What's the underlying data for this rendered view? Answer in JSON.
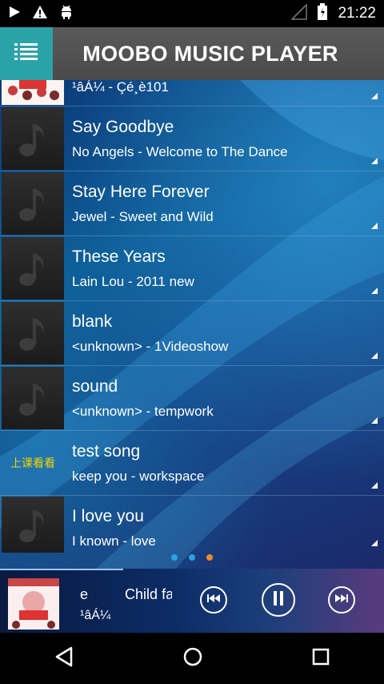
{
  "status_bar": {
    "time": "21:22",
    "left_icons": [
      "play-icon",
      "warning-icon",
      "android-debug-icon"
    ],
    "right_icons": [
      "signal-icon",
      "battery-icon"
    ]
  },
  "header": {
    "title": "MOOBO MUSIC PLAYER",
    "menu_icon": "list-menu-icon"
  },
  "songs": [
    {
      "title": "",
      "subtitle": "¹âÁ¼ - Çé¸è101",
      "thumb": "album-art"
    },
    {
      "title": "Say Goodbye",
      "subtitle": "No Angels - Welcome to The Dance",
      "thumb": "music-note"
    },
    {
      "title": "Stay Here Forever",
      "subtitle": "Jewel - Sweet and Wild",
      "thumb": "music-note"
    },
    {
      "title": "These Years",
      "subtitle": "Lain Lou - 2011 new",
      "thumb": "music-note"
    },
    {
      "title": "blank",
      "subtitle": "<unknown> - 1Videoshow",
      "thumb": "music-note"
    },
    {
      "title": "sound",
      "subtitle": "<unknown> - tempwork",
      "thumb": "music-note"
    },
    {
      "title": "test song",
      "subtitle": "keep you - workspace",
      "thumb": "text",
      "thumb_caption": "上课看看"
    },
    {
      "title": "I love you",
      "subtitle": "I known - love",
      "thumb": "music-note"
    }
  ],
  "page_dots": {
    "count": 3,
    "active": 2,
    "colors": [
      "#2aa3e0",
      "#2aa3e0",
      "#f08a24"
    ]
  },
  "now_playing": {
    "title_fragment_1": "e",
    "title_fragment_2": "Child fa",
    "artist": "¹âÁ¼",
    "progress": 0.32
  },
  "controls": {
    "prev": "previous-icon",
    "pause": "pause-icon",
    "next": "next-icon"
  },
  "nav": [
    "back-icon",
    "home-icon",
    "recents-icon"
  ],
  "colors": {
    "accent": "#2aa3a8",
    "header": "#4e4e4e"
  }
}
